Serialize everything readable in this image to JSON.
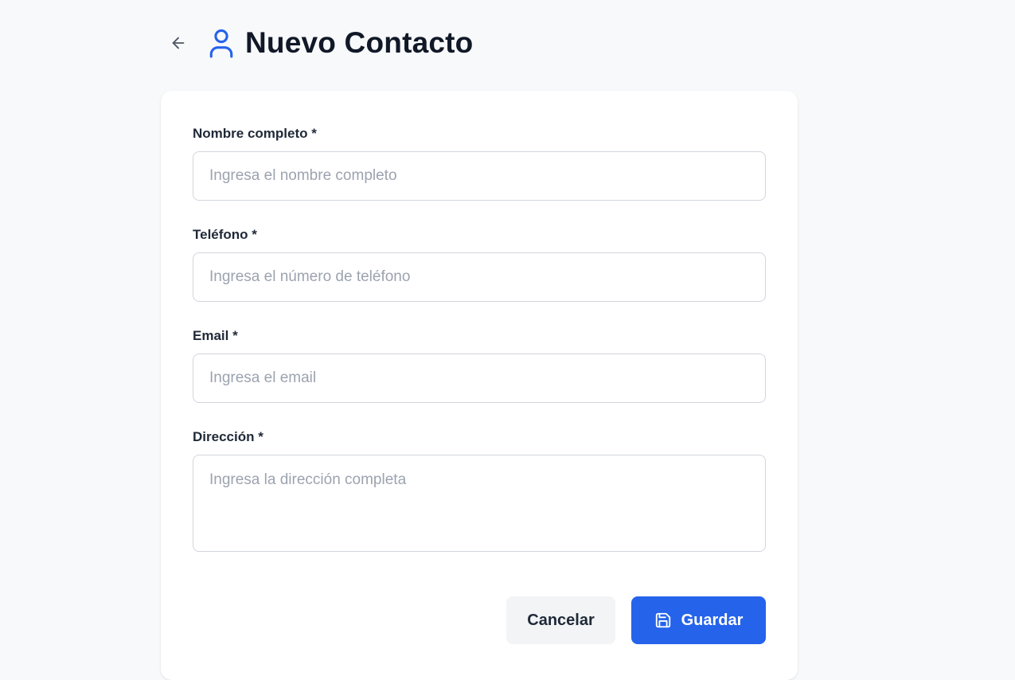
{
  "header": {
    "title": "Nuevo Contacto",
    "back_icon": "arrow-left-icon",
    "title_icon": "user-icon"
  },
  "form": {
    "fields": [
      {
        "label": "Nombre completo *",
        "placeholder": "Ingresa el nombre completo",
        "value": ""
      },
      {
        "label": "Teléfono *",
        "placeholder": "Ingresa el número de teléfono",
        "value": ""
      },
      {
        "label": "Email *",
        "placeholder": "Ingresa el email",
        "value": ""
      },
      {
        "label": "Dirección *",
        "placeholder": "Ingresa la dirección completa",
        "value": ""
      }
    ],
    "cancel_label": "Cancelar",
    "save_label": "Guardar",
    "save_icon": "save-icon"
  },
  "colors": {
    "accent": "#2563eb",
    "background": "#f8f9fb",
    "card": "#ffffff",
    "input_border": "#d1d5db",
    "cancel_bg": "#f3f4f6",
    "title_text": "#111827"
  }
}
